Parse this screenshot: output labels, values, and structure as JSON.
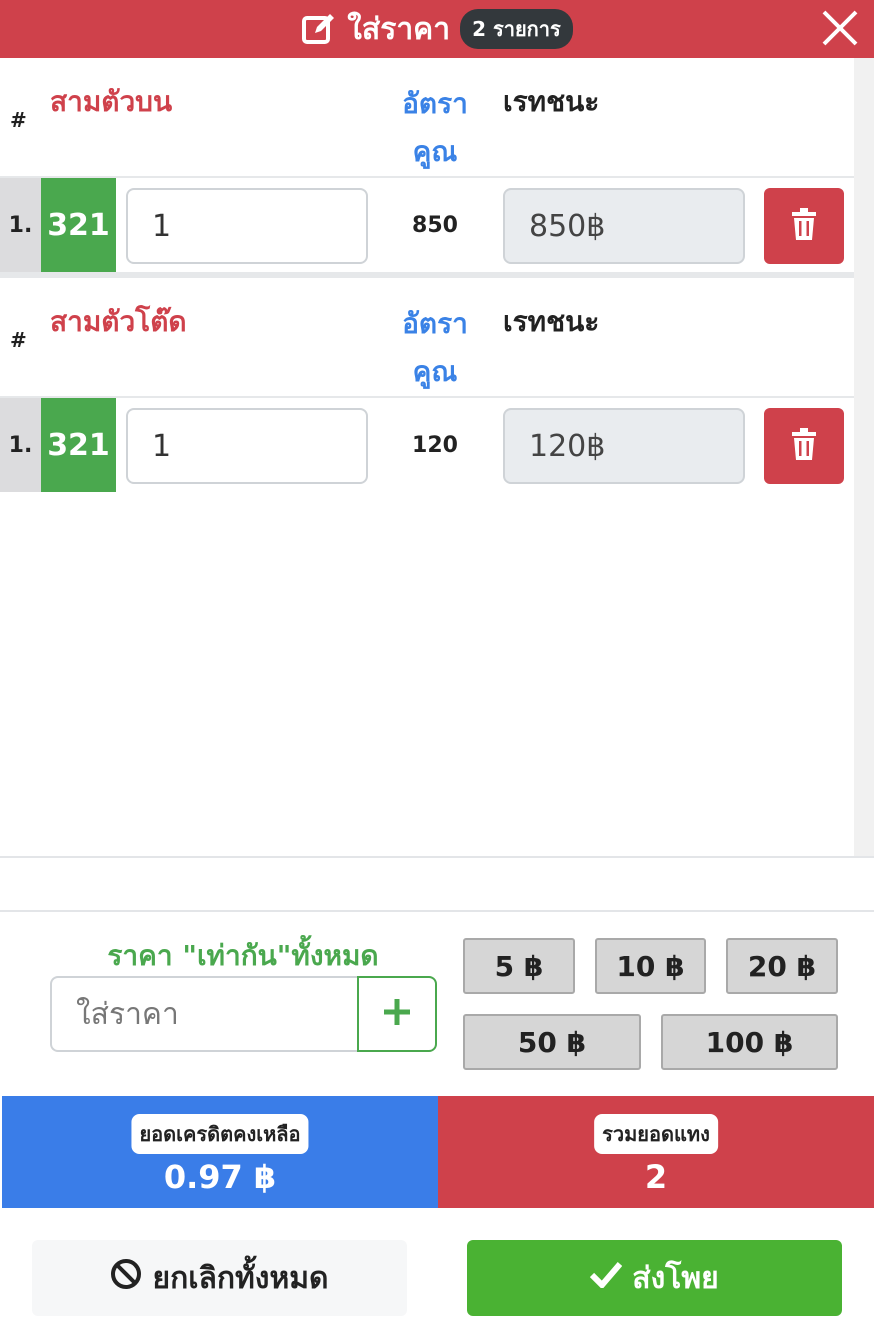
{
  "header": {
    "title": "ใส่ราคา",
    "badge": "2 รายการ",
    "edit_icon": "edit-icon",
    "close_icon": "close-icon"
  },
  "groups": [
    {
      "name": "สามตัวบน",
      "hash": "#",
      "rate_label": "อัตรา คูณ",
      "win_label": "เรทชนะ",
      "rows": [
        {
          "index": "1.",
          "number": "321",
          "amount": "1",
          "rate": "850",
          "win": "850฿"
        }
      ]
    },
    {
      "name": "สามตัวโต๊ด",
      "hash": "#",
      "rate_label": "อัตรา คูณ",
      "win_label": "เรทชนะ",
      "rows": [
        {
          "index": "1.",
          "number": "321",
          "amount": "1",
          "rate": "120",
          "win": "120฿"
        }
      ]
    }
  ],
  "price_all": {
    "label": "ราคา \"เท่ากัน\"ทั้งหมด",
    "placeholder": "ใส่ราคา",
    "plus_icon": "plus-icon"
  },
  "quick_amounts": [
    "5 ฿",
    "10 ฿",
    "20 ฿",
    "50 ฿",
    "100 ฿"
  ],
  "summary": {
    "credit_label": "ยอดเครดิตคงเหลือ",
    "credit_value": "0.97 ฿",
    "total_label": "รวมยอดแทง",
    "total_value": "2"
  },
  "actions": {
    "cancel_label": "ยกเลิกทั้งหมด",
    "submit_label": "ส่งโพย"
  },
  "colors": {
    "header_red": "#cf414b",
    "blue": "#3a7de8",
    "green": "#4aa84e",
    "submit_green": "#4ab233"
  }
}
